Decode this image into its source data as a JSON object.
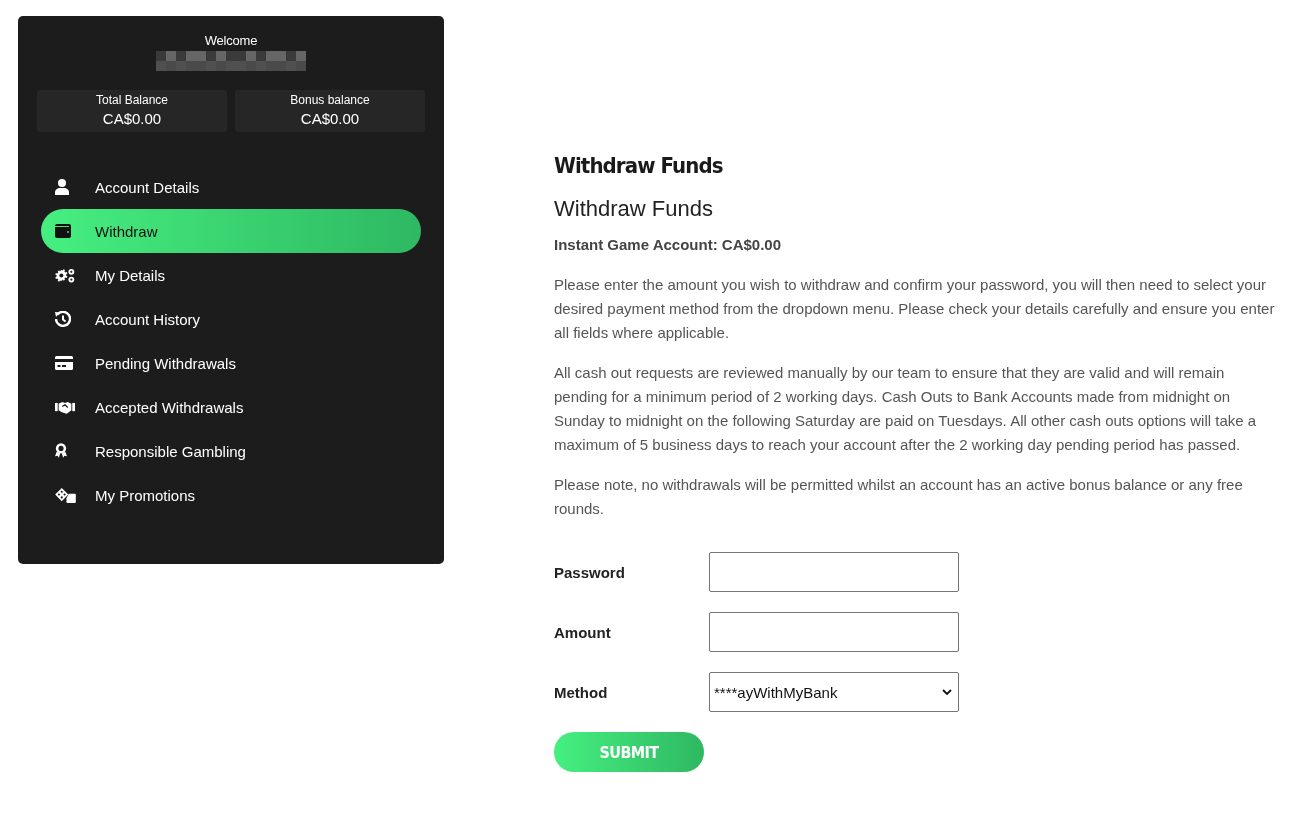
{
  "sidebar": {
    "welcome": "Welcome",
    "balances": [
      {
        "label": "Total Balance",
        "value": "CA$0.00"
      },
      {
        "label": "Bonus balance",
        "value": "CA$0.00"
      }
    ],
    "items": [
      {
        "label": "Account Details",
        "selected": false
      },
      {
        "label": "Withdraw",
        "selected": true
      },
      {
        "label": "My Details",
        "selected": false
      },
      {
        "label": "Account History",
        "selected": false
      },
      {
        "label": "Pending Withdrawals",
        "selected": false
      },
      {
        "label": "Accepted Withdrawals",
        "selected": false
      },
      {
        "label": "Responsible Gambling",
        "selected": false
      },
      {
        "label": "My Promotions",
        "selected": false
      }
    ]
  },
  "main": {
    "page_title": "Withdraw Funds",
    "heading": "Withdraw Funds",
    "account_line": "Instant Game Account: CA$0.00",
    "paragraphs": [
      "Please enter the amount you wish to withdraw and confirm your password, you will then need to select your desired payment method from the dropdown menu. Please check your details carefully and ensure you enter all fields where applicable.",
      "All cash out requests are reviewed manually by our team to ensure that they are valid and will remain pending for a minimum period of 2 working days. Cash Outs to Bank Accounts made from midnight on Sunday to midnight on the following Saturday are paid on Tuesdays. All other cash outs options will take a maximum of 5 business days to reach your account after the 2 working day pending period has passed.",
      "Please note, no withdrawals will be permitted whilst an account has an active bonus balance or any free rounds."
    ],
    "form": {
      "fields": [
        {
          "label": "Password",
          "kind": "password"
        },
        {
          "label": "Amount",
          "kind": "text"
        },
        {
          "label": "Method",
          "kind": "select",
          "value": "****ayWithMyBank"
        }
      ],
      "submit": "SUBMIT"
    }
  }
}
